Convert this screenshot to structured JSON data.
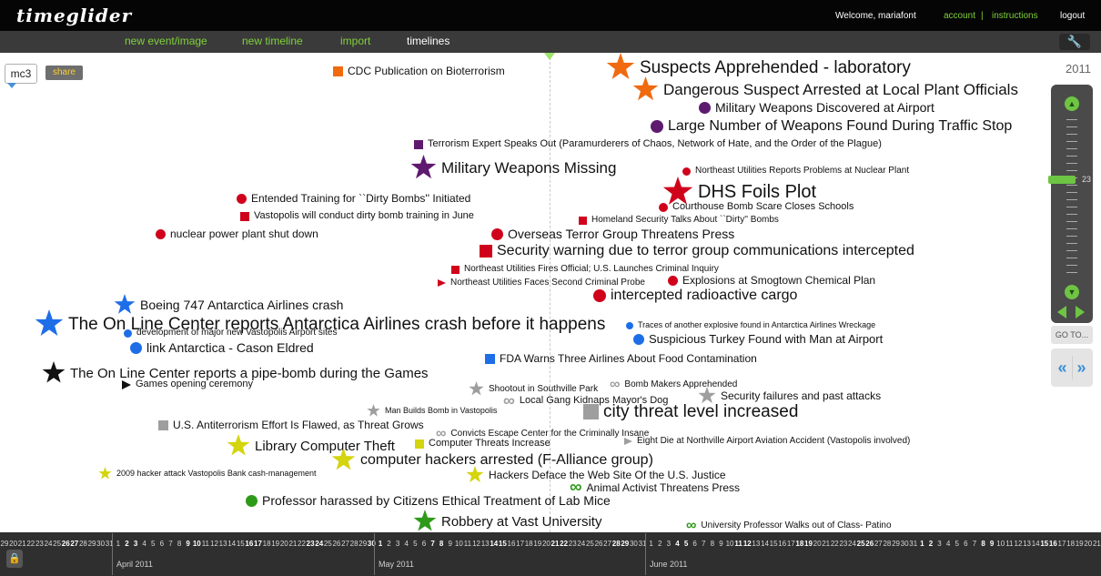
{
  "header": {
    "logo": "timeglider",
    "welcome": "Welcome, mariafont",
    "account": "account",
    "separator": "|",
    "instructions": "instructions",
    "logout": "logout"
  },
  "menu": [
    {
      "label": "new event/image",
      "color": "#7fd13b"
    },
    {
      "label": "new timeline",
      "color": "#7fd13b"
    },
    {
      "label": "import",
      "color": "#7fd13b"
    },
    {
      "label": "timelines",
      "color": "#ffffff"
    }
  ],
  "timeline": {
    "name": "mc3",
    "share": "share"
  },
  "zoom": {
    "year": "2011",
    "level": "23",
    "goto": "GO TO..."
  },
  "events": [
    {
      "label": "CDC Publication on Bioterrorism",
      "icon": "square",
      "color": "#f06a10",
      "size": 12
    },
    {
      "label": "Suspects Apprehended - laboratory",
      "icon": "star",
      "color": "#f06a10",
      "size": 19
    },
    {
      "label": "Dangerous Suspect Arrested at Local Plant Officials",
      "icon": "star",
      "color": "#f06a10",
      "size": 17
    },
    {
      "label": "Military Weapons Discovered at Airport",
      "icon": "circle",
      "color": "#5e1a6e",
      "size": 14
    },
    {
      "label": "Large Number of Weapons Found During Traffic Stop",
      "icon": "circle",
      "color": "#5e1a6e",
      "size": 16
    },
    {
      "label": "Terrorism Expert Speaks Out (Paramurderers of Chaos, Network of Hate, and the Order of the Plague)",
      "icon": "square",
      "color": "#5e1a6e",
      "size": 11
    },
    {
      "label": "Military Weapons Missing",
      "icon": "star",
      "color": "#5e1a6e",
      "size": 17
    },
    {
      "label": "Northeast Utilities Reports Problems at Nuclear Plant",
      "icon": "circle",
      "color": "#d0021b",
      "size": 10
    },
    {
      "label": "DHS Foils Plot",
      "icon": "star",
      "color": "#d0021b",
      "size": 20
    },
    {
      "label": "Entended Training for ``Dirty Bombs'' Initiated",
      "icon": "circle",
      "color": "#d0021b",
      "size": 12
    },
    {
      "label": "Courthouse Bomb Scare Closes Schools",
      "icon": "circle",
      "color": "#d0021b",
      "size": 11
    },
    {
      "label": "Vastopolis will conduct dirty bomb training in June",
      "icon": "square",
      "color": "#d0021b",
      "size": 11
    },
    {
      "label": "Homeland Security Talks About ``Dirty'' Bombs",
      "icon": "square",
      "color": "#d0021b",
      "size": 10
    },
    {
      "label": "nuclear power plant shut down",
      "icon": "circle",
      "color": "#d0021b",
      "size": 12
    },
    {
      "label": "Overseas Terror Group Threatens Press",
      "icon": "circle",
      "color": "#d0021b",
      "size": 14
    },
    {
      "label": "Security warning due to terror group communications intercepted",
      "icon": "square",
      "color": "#d0021b",
      "size": 16
    },
    {
      "label": "Northeast Utilities Fires Official; U.S. Launches Criminal Inquiry",
      "icon": "square",
      "color": "#d0021b",
      "size": 10
    },
    {
      "label": "Northeast Utilities Faces Second Criminal Probe",
      "icon": "triangle",
      "color": "#d0021b",
      "size": 10
    },
    {
      "label": "Explosions at Smogtown Chemical Plan",
      "icon": "circle",
      "color": "#d0021b",
      "size": 12
    },
    {
      "label": "intercepted radioactive cargo",
      "icon": "circle",
      "color": "#d0021b",
      "size": 16
    },
    {
      "label": "Boeing 747 Antarctica Airlines crash",
      "icon": "star",
      "color": "#1e6ee8",
      "size": 14
    },
    {
      "label": "The On Line Center reports Antarctica Airlines crash before it happens",
      "icon": "star",
      "color": "#1e6ee8",
      "size": 19
    },
    {
      "label": "Traces of another explosive found in Antarctica Airlines Wreckage",
      "icon": "circle",
      "color": "#1e6ee8",
      "size": 9
    },
    {
      "label": "development of major new Vastopolis Airport sites",
      "icon": "circle",
      "color": "#1e6ee8",
      "size": 10
    },
    {
      "label": "link Antarctica - Cason Eldred",
      "icon": "circle",
      "color": "#1e6ee8",
      "size": 14
    },
    {
      "label": "Suspicious Turkey Found with Man at Airport",
      "icon": "circle",
      "color": "#1e6ee8",
      "size": 13
    },
    {
      "label": "FDA Warns Three Airlines About Food Contamination",
      "icon": "square",
      "color": "#1e6ee8",
      "size": 12
    },
    {
      "label": "The On Line Center reports a pipe-bomb during the Games",
      "icon": "star",
      "color": "#111111",
      "size": 15
    },
    {
      "label": "Games opening ceremony",
      "icon": "triangle",
      "color": "#111111",
      "size": 11
    },
    {
      "label": "Shootout in Southville Park",
      "icon": "star",
      "color": "#9e9e9e",
      "size": 10
    },
    {
      "label": "Bomb Makers Apprehended",
      "icon": "infinity",
      "color": "#9e9e9e",
      "size": 10
    },
    {
      "label": "Local Gang Kidnaps Mayor's Dog",
      "icon": "infinity",
      "color": "#9e9e9e",
      "size": 11
    },
    {
      "label": "Security failures and past attacks",
      "icon": "star",
      "color": "#9e9e9e",
      "size": 12
    },
    {
      "label": "Man Builds Bomb in Vastopolis",
      "icon": "star",
      "color": "#9e9e9e",
      "size": 9
    },
    {
      "label": "city threat level increased",
      "icon": "square",
      "color": "#9e9e9e",
      "size": 19
    },
    {
      "label": "U.S. Antiterrorism Effort Is Flawed, as Threat Grows",
      "icon": "square",
      "color": "#9e9e9e",
      "size": 12
    },
    {
      "label": "Convicts Escape Center for the Criminally Insane",
      "icon": "infinity",
      "color": "#9e9e9e",
      "size": 10
    },
    {
      "label": "Eight Die at Northville Airport Aviation Accident (Vastopolis involved)",
      "icon": "triangle",
      "color": "#9e9e9e",
      "size": 10
    },
    {
      "label": "Library Computer Theft",
      "icon": "star",
      "color": "#d4d40f",
      "size": 15
    },
    {
      "label": "Computer Threats Increase",
      "icon": "square",
      "color": "#d4d40f",
      "size": 11
    },
    {
      "label": "computer hackers arrested (F-Alliance group)",
      "icon": "star",
      "color": "#d4d40f",
      "size": 16
    },
    {
      "label": "2009 hacker attack Vastopolis Bank cash-management",
      "icon": "star",
      "color": "#d4d40f",
      "size": 9
    },
    {
      "label": "Hackers Deface the Web Site Of the U.S. Justice",
      "icon": "star",
      "color": "#d4d40f",
      "size": 12
    },
    {
      "label": "Animal Activist Threatens Press",
      "icon": "infinity",
      "color": "#2e9a19",
      "size": 12
    },
    {
      "label": "Professor harassed by Citizens Ethical Treatment of Lab Mice",
      "icon": "circle",
      "color": "#2e9a19",
      "size": 14
    },
    {
      "label": "Robbery at Vast University",
      "icon": "star",
      "color": "#2e9a19",
      "size": 15
    },
    {
      "label": "University Professor Walks out of Class- Patino",
      "icon": "infinity",
      "color": "#2e9a19",
      "size": 10
    }
  ],
  "ruler": {
    "days": [
      "29",
      "20",
      "21",
      "22",
      "23",
      "24",
      "25",
      "26",
      "27",
      "28",
      "29",
      "30",
      "31",
      "1",
      "2",
      "3",
      "4",
      "5",
      "6",
      "7",
      "8",
      "9",
      "10",
      "11",
      "12",
      "13",
      "14",
      "15",
      "16",
      "17",
      "18",
      "19",
      "20",
      "21",
      "22",
      "23",
      "24",
      "25",
      "26",
      "27",
      "28",
      "29",
      "30",
      "1",
      "2",
      "3",
      "4",
      "5",
      "6",
      "7",
      "8",
      "9",
      "10",
      "11",
      "12",
      "13",
      "14",
      "15",
      "16",
      "17",
      "18",
      "19",
      "20",
      "21",
      "22",
      "23",
      "24",
      "25",
      "26",
      "27",
      "28",
      "29",
      "30",
      "31",
      "1",
      "2",
      "3",
      "4",
      "5",
      "6",
      "7",
      "8",
      "9",
      "10",
      "11",
      "12",
      "13",
      "14",
      "15",
      "16",
      "17",
      "18",
      "19",
      "20",
      "21",
      "22",
      "23",
      "24",
      "25",
      "26",
      "27",
      "28",
      "29",
      "30",
      "31",
      "1",
      "2",
      "3",
      "4",
      "5",
      "6",
      "7",
      "8",
      "9",
      "10",
      "11",
      "12",
      "13",
      "14",
      "15",
      "16",
      "17",
      "18",
      "19",
      "20",
      "21"
    ],
    "months": [
      "April 2011",
      "May 2011",
      "June 2011"
    ]
  }
}
